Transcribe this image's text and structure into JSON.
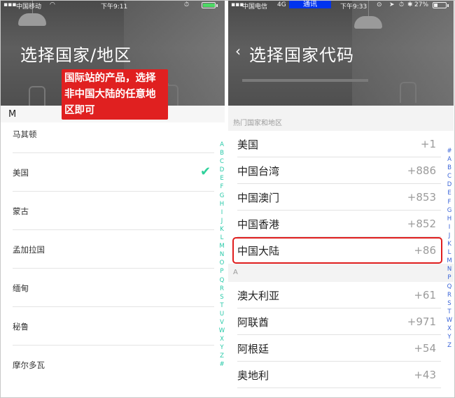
{
  "left": {
    "status": {
      "carrier": "中国移动",
      "time": "下午9:11"
    },
    "title": "选择国家/地区",
    "callout": "国际站的产品，选择非中国大陆的任意地区即可",
    "section_letter": "M",
    "rows": [
      {
        "label": "马其顿",
        "selected": false
      },
      {
        "label": "美国",
        "selected": true
      },
      {
        "label": "蒙古",
        "selected": false
      },
      {
        "label": "孟加拉国",
        "selected": false
      },
      {
        "label": "缅甸",
        "selected": false
      },
      {
        "label": "秘鲁",
        "selected": false
      },
      {
        "label": "摩尔多瓦",
        "selected": false
      }
    ],
    "check_glyph": "✔",
    "index": [
      "A",
      "B",
      "C",
      "D",
      "E",
      "F",
      "G",
      "H",
      "I",
      "J",
      "K",
      "L",
      "M",
      "N",
      "O",
      "P",
      "Q",
      "R",
      "S",
      "T",
      "U",
      "V",
      "W",
      "X",
      "Y",
      "Z",
      "#"
    ]
  },
  "right": {
    "status": {
      "carrier": "中国电信",
      "network": "4G",
      "notice": "通讯",
      "time": "下午9:33",
      "battery": "27%"
    },
    "back_glyph": "‹",
    "title": "选择国家代码",
    "hot_section": "热门国家和地区",
    "hot_rows": [
      {
        "name": "美国",
        "code": "+1"
      },
      {
        "name": "中国台湾",
        "code": "+886"
      },
      {
        "name": "中国澳门",
        "code": "+853"
      },
      {
        "name": "中国香港",
        "code": "+852"
      },
      {
        "name": "中国大陆",
        "code": "+86"
      }
    ],
    "a_section": "A",
    "a_rows": [
      {
        "name": "澳大利亚",
        "code": "+61"
      },
      {
        "name": "阿联酋",
        "code": "+971"
      },
      {
        "name": "阿根廷",
        "code": "+54"
      },
      {
        "name": "奥地利",
        "code": "+43"
      }
    ],
    "index": [
      "#",
      "A",
      "B",
      "C",
      "D",
      "E",
      "F",
      "G",
      "H",
      "I",
      "J",
      "K",
      "L",
      "M",
      "N",
      "P",
      "Q",
      "R",
      "S",
      "T",
      "W",
      "X",
      "Y",
      "Z"
    ]
  },
  "colors": {
    "accent_green": "#2fd19b",
    "index_blue": "#3a64d8",
    "callout_red": "#e02020"
  }
}
